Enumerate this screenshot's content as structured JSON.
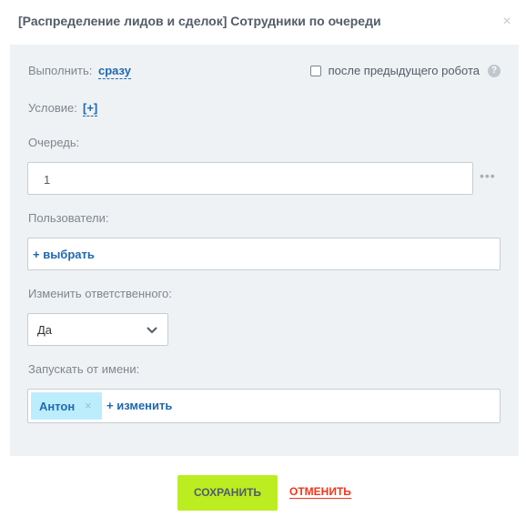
{
  "dialog": {
    "title": "[Распределение лидов и сделок] Сотрудники по очереди",
    "close_glyph": "×"
  },
  "execute": {
    "label": "Выполнить:",
    "value": "сразу",
    "after_previous_label": "после предыдущего робота",
    "after_previous_checked": false,
    "help_glyph": "?"
  },
  "condition": {
    "label": "Условие:",
    "add_link": "[+]"
  },
  "queue": {
    "label": "Очередь:",
    "value": "1",
    "more_glyph": "•••"
  },
  "users": {
    "label": "Пользователи:",
    "select_link": "+ выбрать"
  },
  "change_responsible": {
    "label": "Изменить ответственного:",
    "selected": "Да"
  },
  "run_as": {
    "label": "Запускать от имени:",
    "tag_name": "Антон",
    "tag_remove": "×",
    "change_link": "+ изменить"
  },
  "footer": {
    "save_label": "СОХРАНИТЬ",
    "cancel_label": "ОТМЕНИТЬ"
  },
  "colors": {
    "panel_bg": "#eef2f4",
    "link": "#2067b0",
    "save_bg": "#bbed21",
    "cancel": "#f1361a",
    "tag_bg": "#bcedfc"
  },
  "icons": [
    "close-icon",
    "help-icon",
    "more-dots-icon",
    "chevron-down-icon",
    "tag-remove-icon"
  ]
}
